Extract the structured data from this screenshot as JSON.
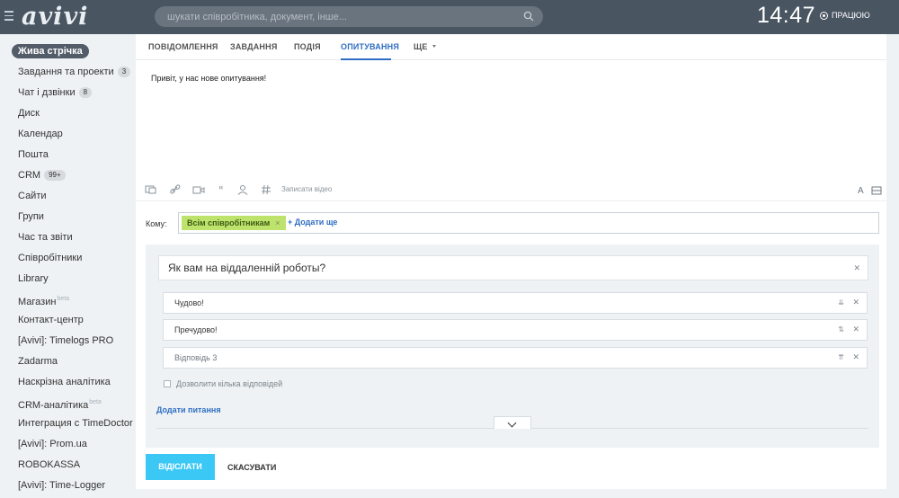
{
  "header": {
    "logo": "avivi",
    "search_placeholder": "шукати співробітника, документ, інше...",
    "clock": "14:47",
    "status": "ПРАЦЮЮ"
  },
  "sidebar": {
    "items": [
      {
        "label": "Жива стрічка"
      },
      {
        "label": "Завдання та проекти",
        "badge": "3"
      },
      {
        "label": "Чат і дзвінки",
        "badge": "8"
      },
      {
        "label": "Диск"
      },
      {
        "label": "Календар"
      },
      {
        "label": "Пошта"
      },
      {
        "label": "CRM",
        "badge": "99+"
      },
      {
        "label": "Сайти"
      },
      {
        "label": "Групи"
      },
      {
        "label": "Час та звіти"
      },
      {
        "label": "Співробітники"
      },
      {
        "label": "Library"
      },
      {
        "label": "Магазин",
        "tag": "beta"
      },
      {
        "label": "Контакт-центр"
      },
      {
        "label": "[Avivi]: Timelogs PRO"
      },
      {
        "label": "Zadarma"
      },
      {
        "label": "Наскрізна аналітика"
      },
      {
        "label": "CRM-аналітика",
        "tag": "beta"
      },
      {
        "label": "Интеграция с TimeDoctor"
      },
      {
        "label": "[Avivi]: Prom.ua"
      },
      {
        "label": "ROBOKASSA"
      },
      {
        "label": "[Avivi]: Time-Logger"
      }
    ]
  },
  "tabs": [
    "ПОВІДОМЛЕННЯ",
    "ЗАВДАННЯ",
    "ПОДІЯ",
    "ОПИТУВАННЯ",
    "ЩЕ"
  ],
  "editor": {
    "text": "Привіт, у нас нове опитування!",
    "record_video": "Записати відео",
    "icons": [
      "file-icon",
      "link-icon",
      "video-icon",
      "quote-icon",
      "mention-icon",
      "hashtag-icon"
    ]
  },
  "recipients": {
    "label": "Кому:",
    "chip": "Всім співробітникам",
    "add_more": "+ Додати ще"
  },
  "poll": {
    "question": "Як вам на віддаленній роботы?",
    "answers": [
      {
        "value": "Чудово!",
        "move": "⇊"
      },
      {
        "value": "Пречудово!",
        "move": "⇅"
      },
      {
        "value": "",
        "placeholder": "Відповідь 3",
        "move": "⇈"
      }
    ],
    "multi_label": "Дозволити кілька відповідей",
    "add_question": "Додати питання"
  },
  "actions": {
    "send": "ВІДІСЛАТИ",
    "cancel": "СКАСУВАТИ"
  },
  "colors": {
    "topbar": "#4a5562",
    "accent": "#2f6ec2",
    "send": "#3bc8f5",
    "chip": "#bde36d"
  }
}
